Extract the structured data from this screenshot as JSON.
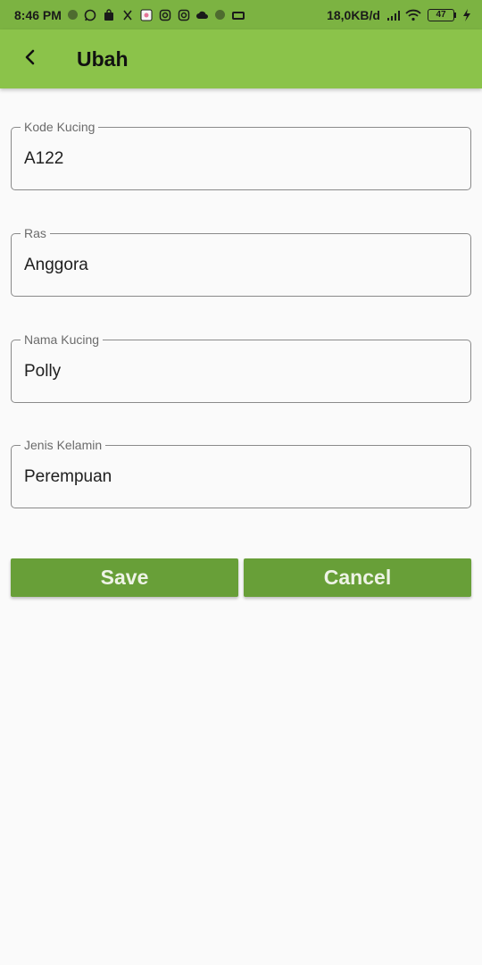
{
  "status_bar": {
    "time": "8:46 PM",
    "net_speed": "18,0KB/d",
    "battery": "47",
    "icons": [
      "dot-icon",
      "whatsapp-icon",
      "shopping-bag-icon",
      "app-icon",
      "photo-icon",
      "instagram-icon",
      "instagram-icon",
      "cloud-icon",
      "dot-icon",
      "game-icon",
      "signal-icon",
      "wifi-icon",
      "battery-icon",
      "charging-icon"
    ]
  },
  "appbar": {
    "back_icon": "chevron-left-icon",
    "title": "Ubah"
  },
  "form": {
    "kode_kucing": {
      "label": "Kode Kucing",
      "value": "A122"
    },
    "ras": {
      "label": "Ras",
      "value": "Anggora"
    },
    "nama_kucing": {
      "label": "Nama Kucing",
      "value": "Polly"
    },
    "jenis_kelamin": {
      "label": "Jenis Kelamin",
      "value": "Perempuan"
    }
  },
  "buttons": {
    "save_label": "Save",
    "cancel_label": "Cancel"
  },
  "colors": {
    "status_bar": "#7cb342",
    "app_bar": "#8bc34a",
    "button": "#689f38",
    "background": "#fafafa"
  }
}
